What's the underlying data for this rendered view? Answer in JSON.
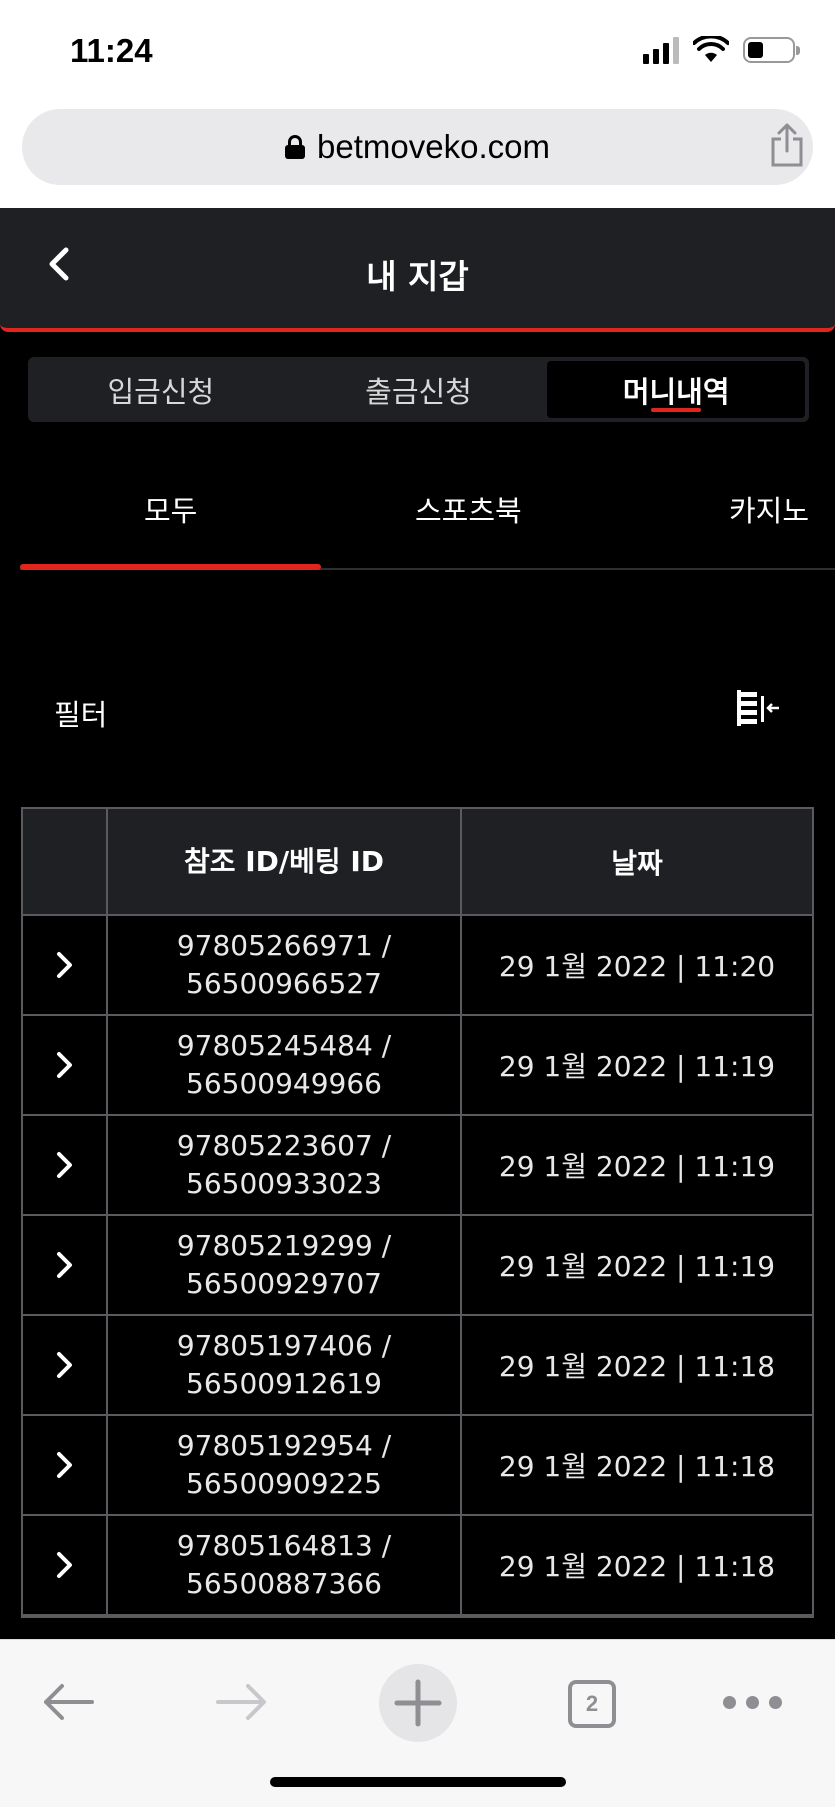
{
  "status_bar": {
    "time": "11:24"
  },
  "browser": {
    "url": "betmoveko.com",
    "tab_count": "2"
  },
  "header": {
    "title": "내 지갑"
  },
  "segments": [
    {
      "label": "입금신청",
      "active": false
    },
    {
      "label": "출금신청",
      "active": false
    },
    {
      "label": "머니내역",
      "active": true
    }
  ],
  "categories": [
    {
      "label": "모두",
      "active": true
    },
    {
      "label": "스포츠북",
      "active": false
    },
    {
      "label": "카지노",
      "active": false
    }
  ],
  "filter": {
    "label": "필터"
  },
  "table": {
    "headers": [
      "참조 ID/베팅 ID",
      "날짜"
    ],
    "rows": [
      {
        "ref_id": "97805266971 /",
        "bet_id": "56500966527",
        "date": "29 1월 2022 | 11:20"
      },
      {
        "ref_id": "97805245484 /",
        "bet_id": "56500949966",
        "date": "29 1월 2022 | 11:19"
      },
      {
        "ref_id": "97805223607 /",
        "bet_id": "56500933023",
        "date": "29 1월 2022 | 11:19"
      },
      {
        "ref_id": "97805219299 /",
        "bet_id": "56500929707",
        "date": "29 1월 2022 | 11:19"
      },
      {
        "ref_id": "97805197406 /",
        "bet_id": "56500912619",
        "date": "29 1월 2022 | 11:18"
      },
      {
        "ref_id": "97805192954 /",
        "bet_id": "56500909225",
        "date": "29 1월 2022 | 11:18"
      },
      {
        "ref_id": "97805164813 /",
        "bet_id": "56500887366",
        "date": "29 1월 2022 | 11:18"
      }
    ]
  },
  "colors": {
    "accent": "#e0261c",
    "header_bg": "#1f2024",
    "page_bg": "#000000"
  }
}
